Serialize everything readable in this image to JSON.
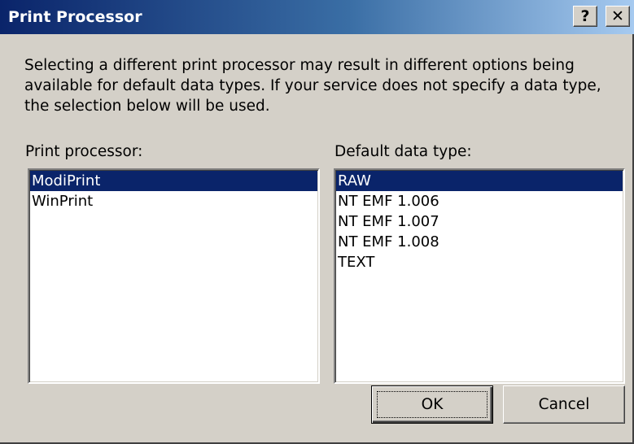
{
  "window": {
    "title": "Print Processor",
    "help_label": "?",
    "close_label": "✕"
  },
  "description": "Selecting a different print processor may result in different options being available for default data types. If your service does not specify a data type, the selection below will be used.",
  "print_processor": {
    "label": "Print processor:",
    "items": [
      "ModiPrint",
      "WinPrint"
    ],
    "selected": "ModiPrint"
  },
  "default_data_type": {
    "label": "Default data type:",
    "items": [
      "RAW",
      "NT EMF 1.006",
      "NT EMF 1.007",
      "NT EMF 1.008",
      "TEXT"
    ],
    "selected": "RAW"
  },
  "buttons": {
    "ok_label": "OK",
    "cancel_label": "Cancel"
  },
  "colors": {
    "selection": "#0a246a",
    "dialog_face": "#d4d0c8",
    "title_gradient_start": "#0a246a",
    "title_gradient_end": "#a6caf0"
  }
}
